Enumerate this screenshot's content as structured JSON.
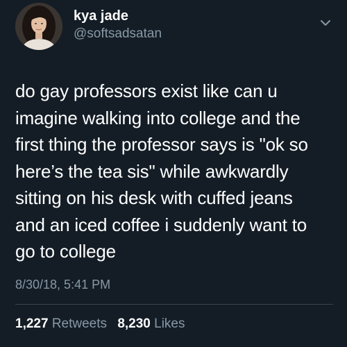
{
  "author": {
    "display_name": "kya jade",
    "handle": "@softsadsatan"
  },
  "icons": {
    "menu": "chevron-down-icon",
    "avatar": "profile-photo"
  },
  "tweet": {
    "lines": [
      "do gay professors exist like can u",
      "imagine walking into college and the",
      "first thing the professor says is \"ok so",
      "here’s the tea sis\" while awkwardly",
      "sitting on his desk with cuffed jeans",
      "and an iced coffee i suddenly want to",
      "go to college"
    ],
    "timestamp": "8/30/18, 5:41 PM"
  },
  "stats": {
    "retweets_count": "1,227",
    "retweets_label": "Retweets",
    "likes_count": "8,230",
    "likes_label": "Likes"
  },
  "colors": {
    "background": "#141d26",
    "primary_text": "#ffffff",
    "secondary_text": "#8899a6",
    "divider": "#38444d"
  }
}
